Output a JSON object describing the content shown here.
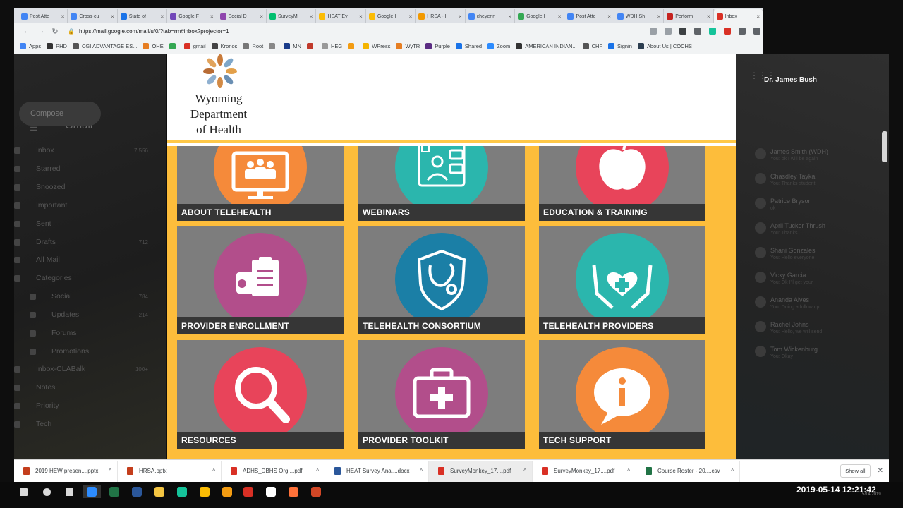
{
  "browser": {
    "tabs": [
      {
        "label": "Post Atte",
        "color": "#4285f4"
      },
      {
        "label": "Cross-cu",
        "color": "#4285f4"
      },
      {
        "label": "State of",
        "color": "#1a73e8"
      },
      {
        "label": "Google F",
        "color": "#7248b9"
      },
      {
        "label": "Social D",
        "color": "#8e44ad"
      },
      {
        "label": "SurveyM",
        "color": "#00bf6f"
      },
      {
        "label": "HEAT Ev",
        "color": "#fbbc04"
      },
      {
        "label": "Google I",
        "color": "#fbbc04"
      },
      {
        "label": "HRSA - I",
        "color": "#f29900"
      },
      {
        "label": "cheyenn",
        "color": "#4285f4"
      },
      {
        "label": "Google I",
        "color": "#34a853"
      },
      {
        "label": "Post Atte",
        "color": "#4285f4"
      },
      {
        "label": "WDH Sh",
        "color": "#4285f4"
      },
      {
        "label": "Perform",
        "color": "#c5221f"
      },
      {
        "label": "Inbox",
        "color": "#d93025"
      }
    ],
    "url": "https://mail.google.com/mail/u/0/?tab=rm#inbox?projector=1",
    "bookmarks": [
      {
        "label": "Apps",
        "color": "#4285f4"
      },
      {
        "label": "PHD",
        "color": "#333333"
      },
      {
        "label": "CGI ADVANTAGE ES...",
        "color": "#555555"
      },
      {
        "label": "OHE",
        "color": "#e67e22"
      },
      {
        "label": "",
        "color": "#34a853"
      },
      {
        "label": "gmail",
        "color": "#d93025"
      },
      {
        "label": "Kronos",
        "color": "#444444"
      },
      {
        "label": "Root",
        "color": "#777777"
      },
      {
        "label": "",
        "color": "#888888"
      },
      {
        "label": "MN",
        "color": "#1a3c8a"
      },
      {
        "label": "",
        "color": "#c0392b"
      },
      {
        "label": "HEG",
        "color": "#999999"
      },
      {
        "label": "",
        "color": "#f39c12"
      },
      {
        "label": "WPress",
        "color": "#f4b400"
      },
      {
        "label": "WyTR",
        "color": "#e67e22"
      },
      {
        "label": "Purple",
        "color": "#5b2c83"
      },
      {
        "label": "Shared",
        "color": "#1a73e8"
      },
      {
        "label": "Zoom",
        "color": "#2d8cff"
      },
      {
        "label": "AMERICAN INDIAN...",
        "color": "#333333"
      },
      {
        "label": "CHF",
        "color": "#555555"
      },
      {
        "label": "Signin",
        "color": "#1a73e8"
      },
      {
        "label": "About Us | COCHS",
        "color": "#2c3e50"
      }
    ]
  },
  "gmail": {
    "logo": "Gmail",
    "compose": "Compose",
    "nav": [
      {
        "label": "Inbox",
        "count": "7,556"
      },
      {
        "label": "Starred",
        "count": ""
      },
      {
        "label": "Snoozed",
        "count": ""
      },
      {
        "label": "Important",
        "count": ""
      },
      {
        "label": "Sent",
        "count": ""
      },
      {
        "label": "Drafts",
        "count": "712"
      },
      {
        "label": "All Mail",
        "count": ""
      },
      {
        "label": "Categories",
        "count": ""
      }
    ],
    "categories": [
      {
        "label": "Social",
        "count": "784"
      },
      {
        "label": "Updates",
        "count": "214"
      },
      {
        "label": "Forums",
        "count": ""
      },
      {
        "label": "Promotions",
        "count": ""
      }
    ],
    "more": [
      {
        "label": "Inbox-CLABalk",
        "count": "100+"
      },
      {
        "label": "Notes",
        "count": ""
      },
      {
        "label": "Priority",
        "count": ""
      },
      {
        "label": "Tech",
        "count": ""
      }
    ],
    "presenter": "Dr. James Bush",
    "contacts": [
      {
        "name": "James Smith (WDH)",
        "status": "You: ok I will be again"
      },
      {
        "name": "Chasdley Tayka",
        "status": "You: Thanks student"
      },
      {
        "name": "Patrice Bryson",
        "status": "ok"
      },
      {
        "name": "April Tucker Thrush",
        "status": "You: Thanks"
      },
      {
        "name": "Shani Gonzales",
        "status": "You: Hello everyone"
      },
      {
        "name": "Vicky Garcia",
        "status": "You: Ok I'll get your"
      },
      {
        "name": "Ananda Alves",
        "status": "You: Doing a follow up"
      },
      {
        "name": "Rachel Johns",
        "status": "You: Hello, we will send"
      },
      {
        "name": "Tom Wickenburg",
        "status": "You: Okay"
      }
    ]
  },
  "page": {
    "org_name_lines": [
      "Wyoming",
      "Department",
      "of Health"
    ],
    "tiles": [
      {
        "label": "ABOUT TELEHEALTH",
        "circle_color": "#f58a3a",
        "icon": "monitor-people-icon"
      },
      {
        "label": "WEBINARS",
        "circle_color": "#2bb6ad",
        "icon": "tablet-doctor-icon"
      },
      {
        "label": "EDUCATION & TRAINING",
        "circle_color": "#e8445a",
        "icon": "apple-icon"
      },
      {
        "label": "PROVIDER ENROLLMENT",
        "circle_color": "#b24e8b",
        "icon": "clipboard-icon"
      },
      {
        "label": "TELEHEALTH CONSORTIUM",
        "circle_color": "#1b7fa6",
        "icon": "shield-stethoscope-icon"
      },
      {
        "label": "TELEHEALTH PROVIDERS",
        "circle_color": "#2bb6ad",
        "icon": "hands-heart-icon"
      },
      {
        "label": "RESOURCES",
        "circle_color": "#e8445a",
        "icon": "magnifier-icon"
      },
      {
        "label": "PROVIDER TOOLKIT",
        "circle_color": "#b24e8b",
        "icon": "medical-kit-icon"
      },
      {
        "label": "TECH SUPPORT",
        "circle_color": "#f58a3a",
        "icon": "info-bubble-icon"
      }
    ]
  },
  "downloads": {
    "items": [
      {
        "name": "2019 HEW presen....pptx",
        "color": "#c43e1c"
      },
      {
        "name": "HRSA.pptx",
        "color": "#c43e1c"
      },
      {
        "name": "ADHS_DBHS Org....pdf",
        "color": "#d93025"
      },
      {
        "name": "HEAT Survey Ana....docx",
        "color": "#2b579a"
      },
      {
        "name": "SurveyMonkey_17....pdf",
        "color": "#d93025"
      },
      {
        "name": "SurveyMonkey_17....pdf",
        "color": "#d93025"
      },
      {
        "name": "Course Roster - 20....csv",
        "color": "#217346"
      }
    ],
    "show_all": "Show all"
  },
  "taskbar": {
    "apps": [
      {
        "name": "windows-start-icon",
        "color": "#ffffff"
      },
      {
        "name": "search-icon",
        "color": "#ffffff"
      },
      {
        "name": "task-view-icon",
        "color": "#ffffff"
      },
      {
        "name": "zoom-icon",
        "color": "#2d8cff"
      },
      {
        "name": "excel-icon",
        "color": "#217346"
      },
      {
        "name": "word-icon",
        "color": "#2b579a"
      },
      {
        "name": "file-explorer-icon",
        "color": "#f4c542"
      },
      {
        "name": "grammarly-icon",
        "color": "#15c39a"
      },
      {
        "name": "chrome-icon",
        "color": "#fbbc04"
      },
      {
        "name": "settings-app-icon",
        "color": "#f39c12"
      },
      {
        "name": "acrobat-icon",
        "color": "#d93025"
      },
      {
        "name": "pdf-reader-icon",
        "color": "#ffffff"
      },
      {
        "name": "firefox-icon",
        "color": "#ff7139"
      },
      {
        "name": "powerpoint-icon",
        "color": "#d24726"
      }
    ],
    "clock": "2019-05-14  12:21:42",
    "date_small": "5/14/2019"
  }
}
